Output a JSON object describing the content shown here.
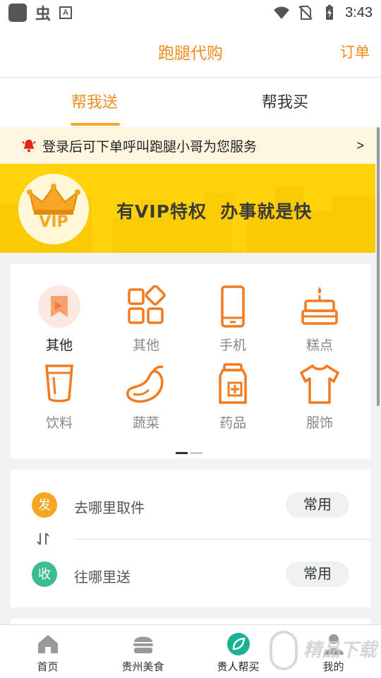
{
  "status_bar": {
    "time": "3:43",
    "icons": [
      "app-square-icon",
      "bug-icon",
      "a-box-icon",
      "wifi-icon",
      "no-sim-icon",
      "battery-charging-icon"
    ]
  },
  "header": {
    "title": "跑腿代购",
    "orders_link": "订单"
  },
  "tabs": [
    {
      "label": "帮我送",
      "active": true
    },
    {
      "label": "帮我买",
      "active": false
    }
  ],
  "notice": {
    "text": "登录后可下单呼叫跑腿小哥为您服务",
    "arrow": ">",
    "icon": "alarm-bell-icon"
  },
  "vip_banner": {
    "badge_text": "VIP",
    "slogan": "有VIP特权  办事就是快",
    "icon": "crown-icon"
  },
  "categories": [
    {
      "label": "其他",
      "icon": "bookmark-icon",
      "active": true
    },
    {
      "label": "其他",
      "icon": "grid-shapes-icon",
      "active": false
    },
    {
      "label": "手机",
      "icon": "phone-icon",
      "active": false
    },
    {
      "label": "糕点",
      "icon": "cake-icon",
      "active": false
    },
    {
      "label": "饮料",
      "icon": "cup-icon",
      "active": false
    },
    {
      "label": "蔬菜",
      "icon": "eggplant-icon",
      "active": false
    },
    {
      "label": "药品",
      "icon": "medicine-bottle-icon",
      "active": false
    },
    {
      "label": "服饰",
      "icon": "tshirt-icon",
      "active": false
    }
  ],
  "pagination": {
    "pages": 2,
    "current": 1
  },
  "address": {
    "pickup": {
      "badge": "发",
      "text": "去哪里取件",
      "common_label": "常用"
    },
    "dropoff": {
      "badge": "收",
      "text": "往哪里送",
      "common_label": "常用"
    }
  },
  "bottom_nav": [
    {
      "label": "首页",
      "icon": "home-icon",
      "active": false
    },
    {
      "label": "贵州美食",
      "icon": "burger-icon",
      "active": false
    },
    {
      "label": "贵人帮买",
      "icon": "leaf-circle-icon",
      "active": true
    },
    {
      "label": "我的",
      "icon": "user-icon",
      "active": false
    }
  ],
  "watermark": "精品下载",
  "colors": {
    "accent": "#f08c1e",
    "vip_yellow": "#ffd30a",
    "pickup_badge": "#f5a623",
    "dropoff_badge": "#3dbd8d",
    "nav_active": "#19b393"
  }
}
